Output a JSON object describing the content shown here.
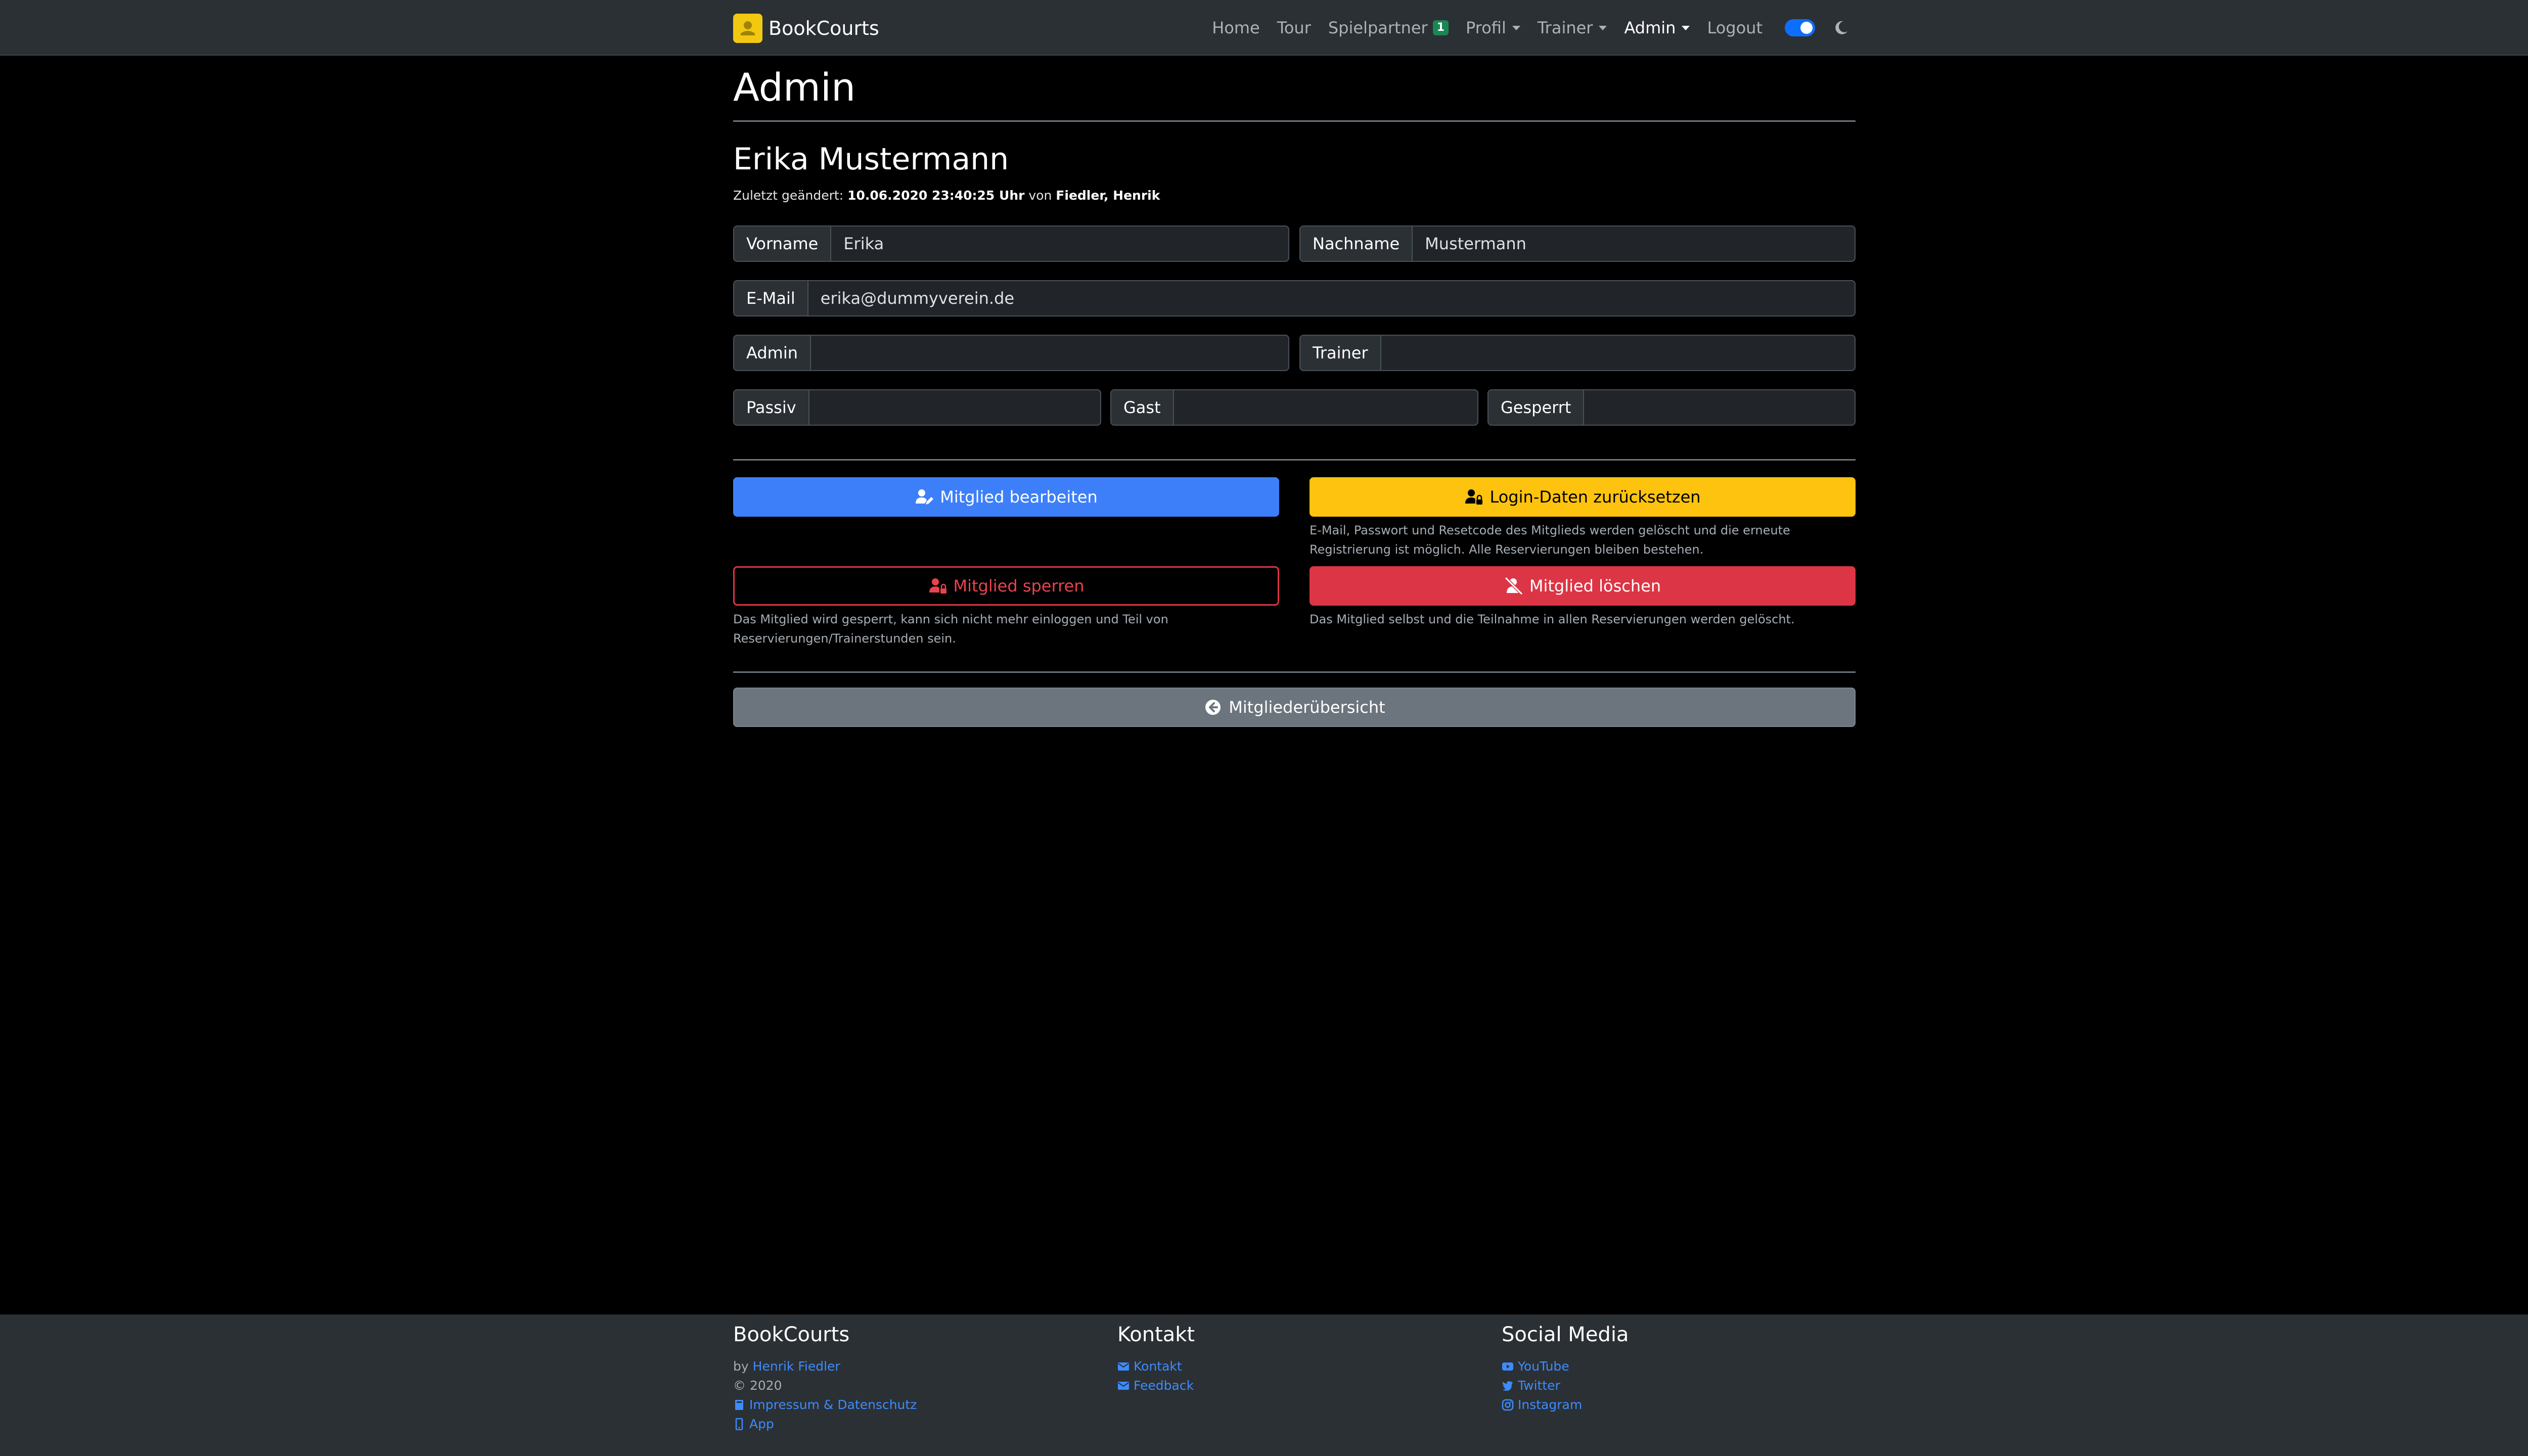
{
  "navbar": {
    "brand": "BookCourts",
    "links": {
      "home": "Home",
      "tour": "Tour",
      "spielpartner": "Spielpartner",
      "spielpartner_badge": "1",
      "profil": "Profil",
      "trainer": "Trainer",
      "admin": "Admin",
      "logout": "Logout"
    },
    "dark_mode_on": true
  },
  "page": {
    "title": "Admin",
    "member_name": "Erika Mustermann",
    "last_changed_prefix": "Zuletzt geändert:",
    "last_changed_datetime": "10.06.2020 23:40:25 Uhr",
    "last_changed_by_prefix": "von",
    "last_changed_by": "Fiedler, Henrik"
  },
  "fields": {
    "vorname": {
      "label": "Vorname",
      "value": "Erika"
    },
    "nachname": {
      "label": "Nachname",
      "value": "Mustermann"
    },
    "email": {
      "label": "E-Mail",
      "value": "erika@dummyverein.de"
    },
    "admin": {
      "label": "Admin",
      "value": ""
    },
    "trainer": {
      "label": "Trainer",
      "value": ""
    },
    "passiv": {
      "label": "Passiv",
      "value": ""
    },
    "gast": {
      "label": "Gast",
      "value": ""
    },
    "gesperrt": {
      "label": "Gesperrt",
      "value": ""
    }
  },
  "actions": {
    "edit": {
      "label": "Mitglied bearbeiten"
    },
    "reset_login": {
      "label": "Login-Daten zurücksetzen",
      "hint_line1": "E-Mail, Passwort und Resetcode des Mitglieds werden gelöscht und die erneute",
      "hint_line2": "Registrierung ist möglich. Alle Reservierungen bleiben bestehen."
    },
    "block": {
      "label": "Mitglied sperren",
      "hint_line1": "Das Mitglied wird gesperrt, kann sich nicht mehr einloggen und Teil von",
      "hint_line2": "Reservierungen/Trainerstunden sein."
    },
    "delete": {
      "label": "Mitglied löschen",
      "hint": "Das Mitglied selbst und die Teilnahme in allen Reservierungen werden gelöscht."
    },
    "overview": {
      "label": "Mitgliederübersicht"
    }
  },
  "footer": {
    "bookcourts": {
      "heading": "BookCourts",
      "by_prefix": "by",
      "author": "Henrik Fiedler",
      "copyright": "© 2020",
      "impressum": "Impressum & Datenschutz",
      "app": "App"
    },
    "kontakt": {
      "heading": "Kontakt",
      "kontakt": "Kontakt",
      "feedback": "Feedback"
    },
    "social": {
      "heading": "Social Media",
      "youtube": "YouTube",
      "twitter": "Twitter",
      "instagram": "Instagram"
    }
  },
  "colors": {
    "primary": "#3d7ff9",
    "warning": "#fdc30e",
    "danger": "#dc3545",
    "secondary": "#6c757d",
    "success": "#198754",
    "navbar_bg": "#2b3035"
  },
  "icons": {
    "brand": "bookcourts-logo-icon",
    "theme": "moon-icon",
    "edit": "user-edit-icon",
    "reset": "user-lock-icon",
    "block": "user-lock-icon",
    "delete": "user-slash-icon",
    "overview": "circle-arrow-left-icon"
  }
}
